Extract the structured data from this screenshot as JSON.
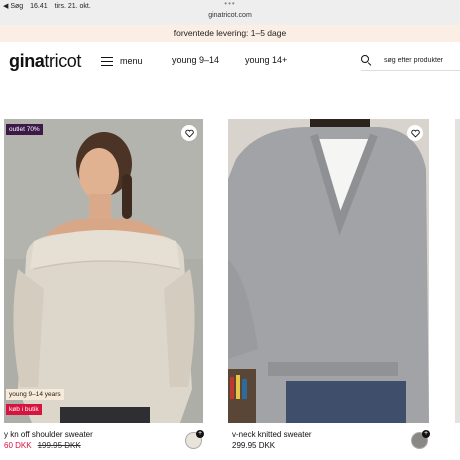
{
  "status_bar": {
    "back": "◀ Søg",
    "time": "16.41",
    "date": "tirs. 21. okt.",
    "dots": "•••",
    "url": "ginatricot.com"
  },
  "banner": {
    "text": "forventede levering: 1–5 dage"
  },
  "header": {
    "logo_bold": "gina",
    "logo_regular": "tricot",
    "menu_label": "menu",
    "nav": [
      "young 9–14",
      "young 14+"
    ],
    "search_placeholder": "søg efter produkter"
  },
  "products": [
    {
      "name": "y kn off shoulder sweater",
      "price": "60 DKK",
      "old_price": "199.95 DKK",
      "badges": {
        "outlet": "outlet 70%",
        "age": "young 9–14 years",
        "store": "køb i butik"
      },
      "swatch_color": "#e9e4da"
    },
    {
      "name": "v-neck knitted sweater",
      "price": "299.95 DKK",
      "swatch_color": "#8a8884"
    }
  ],
  "colors": {
    "accent_red": "#d6143f",
    "outlet_badge": "#3b1a48",
    "banner_bg": "#fbeee5"
  }
}
